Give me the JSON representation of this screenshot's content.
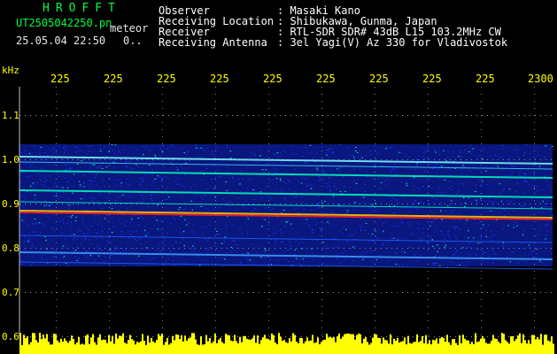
{
  "header": {
    "brand": "HROFFT",
    "filename": "UT2505042250.pn",
    "filename_suffix": "meteor",
    "datetime": "25.05.04 22:50",
    "counter": "0.."
  },
  "info": {
    "labels": [
      "Observer",
      "Receiving Location",
      "Receiver",
      "Receiving Antenna"
    ],
    "values": [
      ": Masaki Kano",
      ": Shibukawa, Gunma, Japan",
      ": RTL-SDR SDR# 43dB L15 103.2MHz CW",
      ": 3el Yagi(V) Az 330 for Vladivostok"
    ]
  },
  "xaxis": {
    "ticks": [
      "225",
      "225",
      "225",
      "225",
      "225",
      "225",
      "225",
      "225",
      "225",
      "2300"
    ]
  },
  "yaxis": {
    "unit": "kHz",
    "ticks": [
      "1.1",
      "1.0",
      "0.9",
      "0.8",
      "0.7",
      "0.6"
    ]
  },
  "colors": {
    "background": "#000000",
    "noise": "#1e32ff",
    "signal_mid": "#00ffc0",
    "signal_strong": "#ff2020",
    "grid": "#ffffff",
    "axis_text": "#ffff00",
    "level_bar": "#ffff00"
  }
}
